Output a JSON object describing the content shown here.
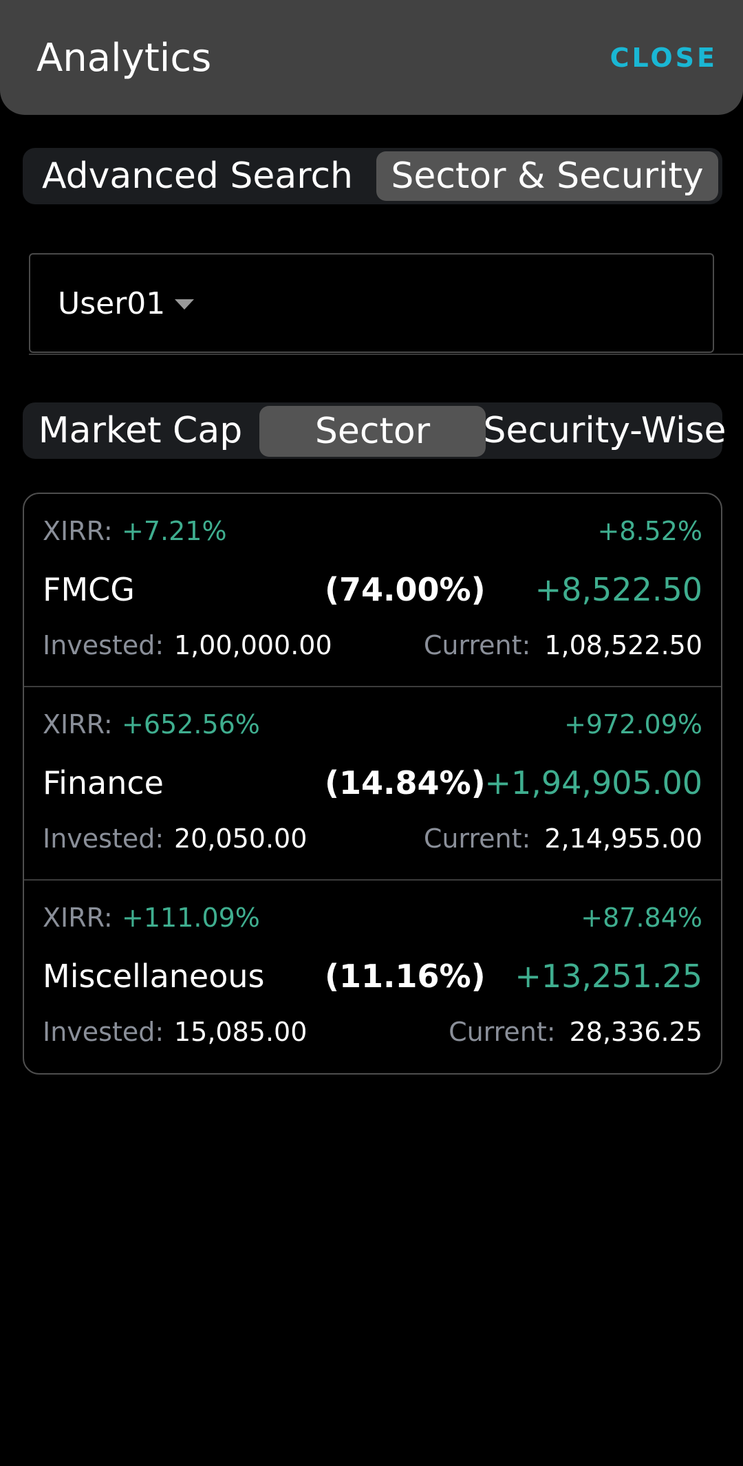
{
  "header": {
    "title": "Analytics",
    "close_label": "CLOSE"
  },
  "top_tabs": [
    {
      "label": "Advanced Search",
      "active": false
    },
    {
      "label": "Sector & Security",
      "active": true
    }
  ],
  "user_select": {
    "value": "User01"
  },
  "view_tabs": [
    {
      "label": "Market Cap",
      "active": false
    },
    {
      "label": "Sector",
      "active": true
    },
    {
      "label": "Security-Wise",
      "active": false
    }
  ],
  "labels": {
    "xirr": "XIRR:",
    "invested": "Invested:",
    "current": "Current:"
  },
  "sectors": [
    {
      "name": "FMCG",
      "share": "(74.00%)",
      "xirr": "+7.21%",
      "pct_change": "+8.52%",
      "pnl": "+8,522.50",
      "invested": "1,00,000.00",
      "current": "1,08,522.50"
    },
    {
      "name": "Finance",
      "share": "(14.84%)",
      "xirr": "+652.56%",
      "pct_change": "+972.09%",
      "pnl": "+1,94,905.00",
      "invested": "20,050.00",
      "current": "2,14,955.00"
    },
    {
      "name": "Miscellaneous",
      "share": "(11.16%)",
      "xirr": "+111.09%",
      "pct_change": "+87.84%",
      "pnl": "+13,251.25",
      "invested": "15,085.00",
      "current": "28,336.25"
    }
  ],
  "colors": {
    "accent": "#1ab7d4",
    "positive": "#3fae8f",
    "muted": "#8a8f99",
    "header_bg": "#424242",
    "active_tab": "#545454"
  }
}
